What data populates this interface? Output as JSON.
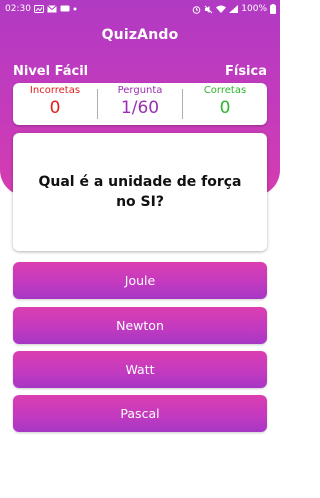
{
  "status_bar": {
    "time": "02:30",
    "battery": "100%"
  },
  "app": {
    "title": "QuizAndo"
  },
  "quiz": {
    "level": "Nivel Fácil",
    "subject": "Física"
  },
  "score": {
    "wrong_label": "Incorretas",
    "wrong_value": "0",
    "question_label": "Pergunta",
    "question_value": "1/60",
    "right_label": "Corretas",
    "right_value": "0"
  },
  "question": {
    "text": "Qual é a unidade de força no SI?"
  },
  "answers": [
    "Joule",
    "Newton",
    "Watt",
    "Pascal"
  ],
  "colors": {
    "header": "#c43bbc",
    "wrong": "#e0201f",
    "question": "#9b2fb4",
    "right": "#2fb52f"
  }
}
